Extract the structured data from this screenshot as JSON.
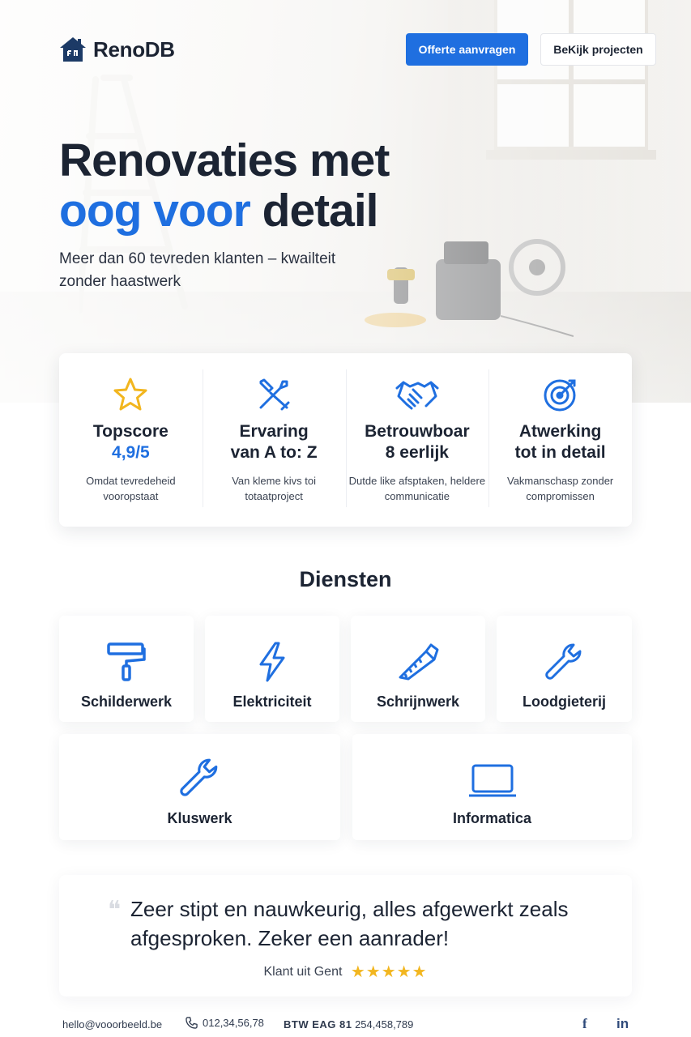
{
  "brand": {
    "name": "RenoDB"
  },
  "header": {
    "cta_primary": "Offerte aanvragen",
    "cta_secondary": "BeKijk projecten"
  },
  "hero": {
    "title_line1": "Renovaties met",
    "title_accent": "oog voor",
    "title_rest": " detail",
    "subtitle": "Meer dan 60 tevreden klanten – kwailteit zonder haastwerk"
  },
  "features": [
    {
      "icon": "star-icon",
      "title": "Topscore",
      "sub": "4,9/5",
      "desc": "Omdat tevredeheid vooropstaat"
    },
    {
      "icon": "tools-icon",
      "title": "Ervaring",
      "sub": "van A to: Z",
      "desc": "Van kleme kivs toi totaatproject"
    },
    {
      "icon": "handshake-icon",
      "title": "Betrouwboar",
      "sub": "8 eerlijk",
      "desc": "Dutde like afsptaken, heldere communicatie"
    },
    {
      "icon": "target-icon",
      "title": "Atwerking",
      "sub": "tot in detail",
      "desc": "Vakmanschasp zonder compromissen"
    }
  ],
  "services": {
    "title": "Diensten",
    "items": [
      {
        "icon": "paint-roller-icon",
        "label": "Schilderwerk"
      },
      {
        "icon": "lightning-icon",
        "label": "Elektriciteit"
      },
      {
        "icon": "saw-icon",
        "label": "Schrijnwerk"
      },
      {
        "icon": "wrench-icon",
        "label": "Loodgieterij"
      },
      {
        "icon": "wrench-icon",
        "label": "Kluswerk"
      },
      {
        "icon": "laptop-icon",
        "label": "Informatica"
      }
    ]
  },
  "testimonial": {
    "quote": "Zeer stipt en nauwkeurig, alles afgewerkt zeals afgesproken. Zeker een aanrader!",
    "author": "Klant uit Gent",
    "stars": "★★★★★",
    "rating": 5
  },
  "footer": {
    "email": "hello@vooorbeeld.be",
    "phone": "012,34,56,78",
    "vat_label": "BTW EAG 81",
    "vat_number": " 254,458,789",
    "social": [
      "f",
      "in"
    ]
  },
  "colors": {
    "accent": "#1f6fe0",
    "text": "#1c2433",
    "star": "#f2b61f"
  }
}
